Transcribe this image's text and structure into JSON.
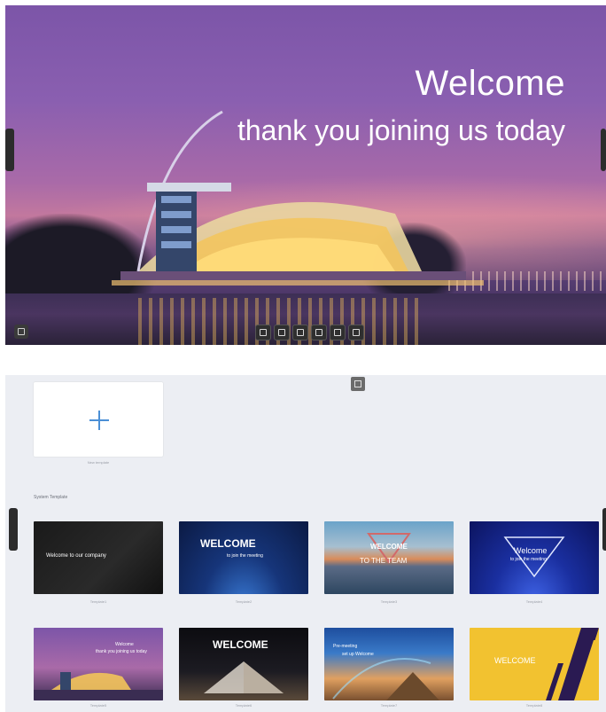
{
  "hero": {
    "title": "Welcome",
    "subtitle": "thank you joining us today",
    "toolbar_icons": [
      "whiteboard-icon",
      "window-icon",
      "apps-icon",
      "screen-icon",
      "settings-icon",
      "pen-icon"
    ]
  },
  "gallery": {
    "new_template_label": "New template",
    "section_title": "System Template",
    "templates": [
      {
        "title": "Welcome to our company",
        "label": "Template1"
      },
      {
        "title": "WELCOME",
        "subtitle": "to join the meeting",
        "label": "Template2"
      },
      {
        "title": "WELCOME",
        "subtitle": "TO THE TEAM",
        "label": "Template3"
      },
      {
        "title": "Welcome",
        "subtitle": "to join the meeting",
        "label": "Template4"
      },
      {
        "title": "Welcome",
        "subtitle": "thank you joining us today",
        "label": "Template5"
      },
      {
        "title": "WELCOME",
        "label": "Template6"
      },
      {
        "title": "Pre-meeting",
        "subtitle": "set up Welcome",
        "label": "Template7"
      },
      {
        "title": "WELCOME",
        "label": "Template8"
      }
    ]
  },
  "colors": {
    "accent": "#4b8fd6",
    "hero_purple": "#7c55a8",
    "gallery_bg": "#eceef3"
  }
}
